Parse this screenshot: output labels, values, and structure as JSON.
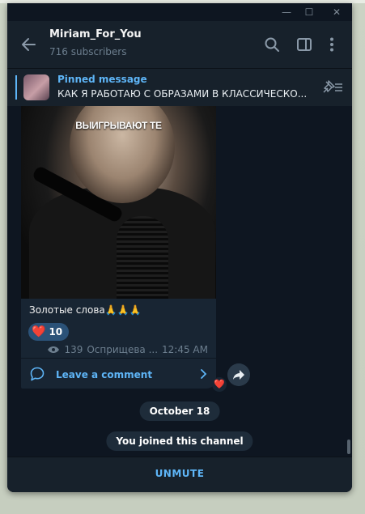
{
  "window": {
    "minimize_glyph": "—",
    "maximize_glyph": "☐",
    "close_glyph": "✕"
  },
  "header": {
    "title": "Miriam_For_You",
    "subtitle": "716 subscribers",
    "icons": [
      "back-arrow-icon",
      "search-icon",
      "sidebar-toggle-icon",
      "more-vertical-icon"
    ]
  },
  "pinned": {
    "title": "Pinned message",
    "text": "КАК Я РАБОТАЮ С ОБРАЗАМИ В КЛАССИЧЕСКО...",
    "icon": "pin-list-icon"
  },
  "message": {
    "video_caption": "ВЫИГРЫВАЮТ ТЕ",
    "text": "Золотые слова🙏🙏🙏",
    "reaction": {
      "emoji": "❤️",
      "count": "10"
    },
    "views": "139",
    "author": "Осприщева ...",
    "time": "12:45 AM",
    "comment_label": "Leave a comment",
    "comment_reaction": "❤️"
  },
  "service": {
    "date": "October 18",
    "joined": "You joined this channel"
  },
  "bottom": {
    "action": "UNMUTE"
  },
  "colors": {
    "accent": "#5eb5f7",
    "window_bg": "#0e1621",
    "panel_bg": "#17212b",
    "bubble_bg": "#182533",
    "reaction_bg": "#2b5278"
  }
}
